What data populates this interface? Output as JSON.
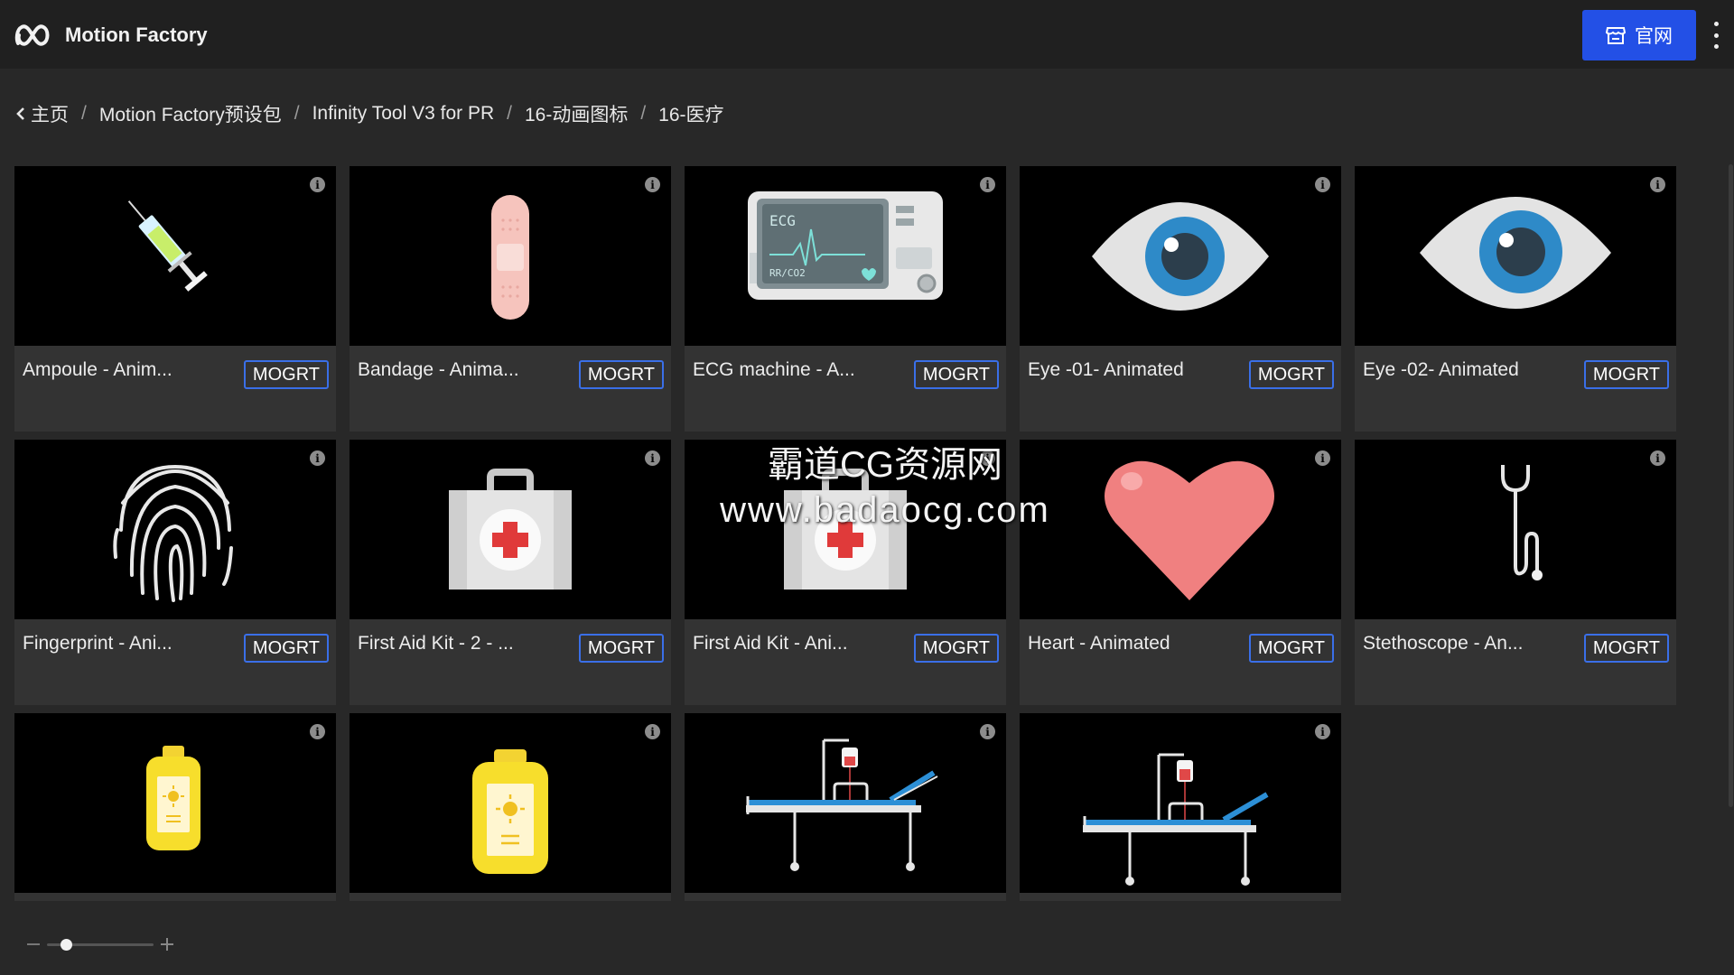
{
  "app": {
    "title": "Motion Factory"
  },
  "header": {
    "site_button_label": "官网",
    "site_icon": "store-icon",
    "menu_icon": "kebab-icon"
  },
  "breadcrumb": {
    "items": [
      "主页",
      "Motion Factory预设包",
      "Infinity Tool V3 for PR",
      "16-动画图标",
      "16-医疗"
    ],
    "separator": "/"
  },
  "cards": [
    {
      "title": "Ampoule - Anim...",
      "badge": "MOGRT",
      "icon": "syringe-icon"
    },
    {
      "title": "Bandage - Anima...",
      "badge": "MOGRT",
      "icon": "bandage-icon"
    },
    {
      "title": "ECG machine - A...",
      "badge": "MOGRT",
      "icon": "ecg-machine-icon",
      "screen_text": "ECG",
      "screen_sub": "RR/CO2"
    },
    {
      "title": "Eye -01- Animated",
      "badge": "MOGRT",
      "icon": "eye-icon"
    },
    {
      "title": "Eye -02- Animated",
      "badge": "MOGRT",
      "icon": "eye-icon"
    },
    {
      "title": "Fingerprint - Ani...",
      "badge": "MOGRT",
      "icon": "fingerprint-icon"
    },
    {
      "title": "First Aid Kit - 2 - ...",
      "badge": "MOGRT",
      "icon": "first-aid-kit-icon"
    },
    {
      "title": "First Aid Kit - Ani...",
      "badge": "MOGRT",
      "icon": "first-aid-kit-icon"
    },
    {
      "title": "Heart - Animated",
      "badge": "MOGRT",
      "icon": "heart-icon"
    },
    {
      "title": "Stethoscope - An...",
      "badge": "MOGRT",
      "icon": "stethoscope-icon"
    },
    {
      "title": "",
      "badge": "",
      "icon": "medicine-bottle-icon"
    },
    {
      "title": "",
      "badge": "",
      "icon": "medicine-bottle-icon"
    },
    {
      "title": "",
      "badge": "",
      "icon": "hospital-bed-icon"
    },
    {
      "title": "",
      "badge": "",
      "icon": "hospital-bed-icon"
    }
  ],
  "info_glyph": "i",
  "zoom": {
    "level": 0.18
  },
  "watermark": {
    "line1": "霸道CG资源网",
    "line2": "www.badaocg.com"
  },
  "colors": {
    "accent": "#2350e6",
    "badge_border": "#3a6fe8",
    "thumb_bg": "#000000",
    "card_bg": "#333333"
  }
}
